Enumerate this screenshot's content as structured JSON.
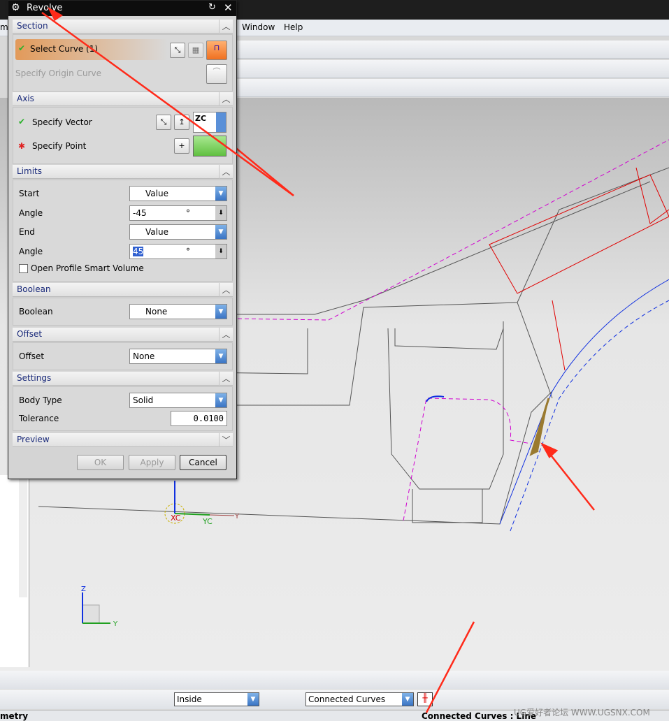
{
  "menubar": {
    "items": [
      "mb",
      "Window",
      "Help"
    ]
  },
  "dialog": {
    "title": "Revolve",
    "sections": {
      "section": {
        "label": "Section",
        "select_curve": "Select Curve (1)",
        "specify_origin_curve": "Specify Origin Curve"
      },
      "axis": {
        "label": "Axis",
        "specify_vector": "Specify Vector",
        "vector_option": "ZC",
        "specify_point": "Specify Point"
      },
      "limits": {
        "label": "Limits",
        "start_label": "Start",
        "start_value": "Value",
        "angle1_label": "Angle",
        "angle1_value": "-45",
        "angle_unit": "°",
        "end_label": "End",
        "end_value": "Value",
        "angle2_label": "Angle",
        "angle2_value": "45",
        "open_profile": "Open Profile Smart Volume",
        "open_profile_checked": false
      },
      "boolean": {
        "label": "Boolean",
        "field_label": "Boolean",
        "value": "None"
      },
      "offset": {
        "label": "Offset",
        "field_label": "Offset",
        "value": "None"
      },
      "settings": {
        "label": "Settings",
        "body_type_label": "Body Type",
        "body_type": "Solid",
        "tolerance_label": "Tolerance",
        "tolerance": "0.0100"
      },
      "preview": {
        "label": "Preview"
      }
    },
    "buttons": {
      "ok": "OK",
      "apply": "Apply",
      "cancel": "Cancel"
    }
  },
  "viewport": {
    "wcs_labels": {
      "xc": "XC",
      "yc": "YC",
      "y": "Y"
    },
    "triad": {
      "z": "Z",
      "y": "Y"
    }
  },
  "bottom_toolbar": {
    "selection_scope": "Inside",
    "curve_rule": "Connected Curves"
  },
  "status": {
    "left": "metry",
    "right": "Connected Curves : Line"
  },
  "watermark": "UG爱好者论坛 WWW.UGSNX.COM",
  "colors": {
    "annotation_arrow": "#ff2a1a",
    "section_curve": "#e00000",
    "selected_curve": "#1030e0",
    "dashed_magenta": "#d000d0"
  }
}
